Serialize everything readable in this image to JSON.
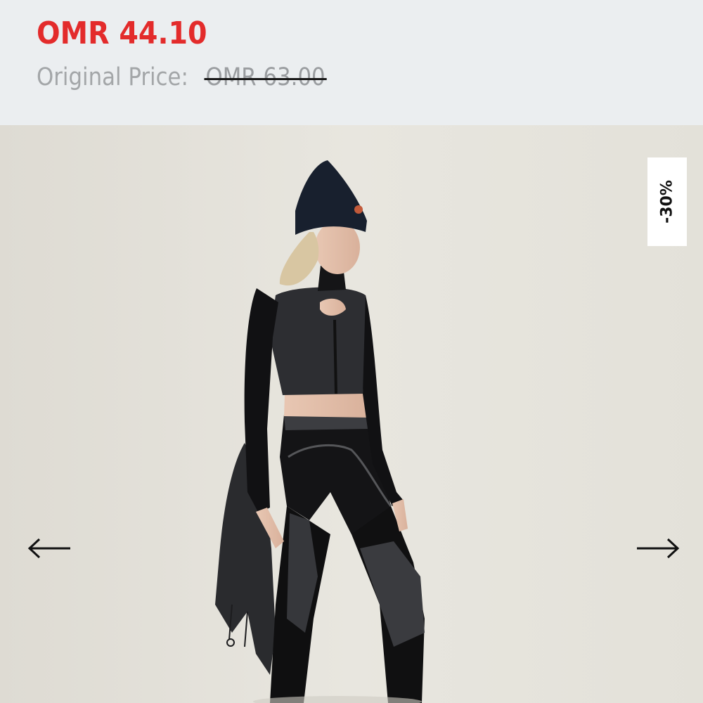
{
  "price": {
    "sale": "OMR 44.10",
    "original_label": "Original Price:",
    "original_value": "OMR 63.00",
    "sale_color": "#e32b2b"
  },
  "gallery": {
    "discount_badge": "-30%",
    "prev_icon": "arrow-left-icon",
    "next_icon": "arrow-right-icon"
  }
}
